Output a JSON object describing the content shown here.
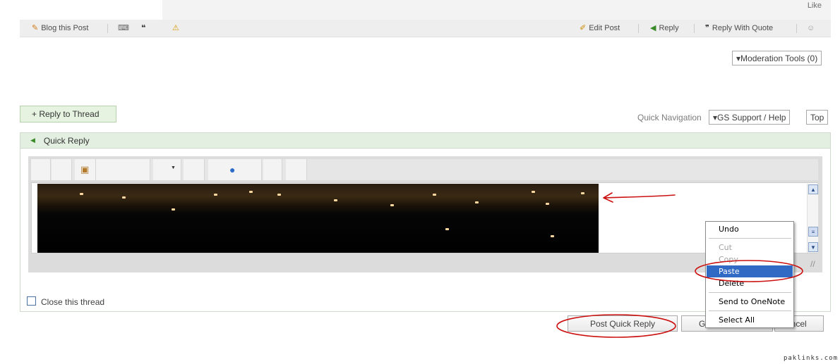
{
  "top": {
    "like_label": "Like"
  },
  "post_toolbar": {
    "blog_this_post": "Blog this Post",
    "edit_post": "Edit Post",
    "reply": "Reply",
    "reply_with_quote": "Reply With Quote"
  },
  "moderation_tools": "▾Moderation Tools (0)",
  "reply_to_thread": "+ Reply to Thread",
  "quick_navigation": {
    "label": "Quick Navigation",
    "selected": "▾GS Support / Help",
    "top_button": "Top"
  },
  "quick_reply": {
    "title": "Quick Reply"
  },
  "close_thread_label": "Close this thread",
  "buttons": {
    "post_quick_reply": "Post Quick Reply",
    "go_advanced_partial": "G",
    "cancel_partial": "ancel"
  },
  "context_menu": {
    "undo": "Undo",
    "cut": "Cut",
    "copy": "Copy",
    "paste": "Paste",
    "delete": "Delete",
    "send_to_onenote": "Send to OneNote",
    "select_all": "Select All"
  },
  "watermark": "paklinks.com",
  "colors": {
    "annotation_red": "#cc1111",
    "selection_blue": "#316ac5",
    "header_green": "#e3efe0"
  },
  "icons": [
    "blog-icon",
    "keyboard-icon",
    "multiquote-icon",
    "warning-icon",
    "edit-pencil-icon",
    "reply-arrow-icon",
    "quote-icon",
    "thanks-icon",
    "insert-image-icon",
    "smiley-icon",
    "collapse-arrow-icon"
  ]
}
